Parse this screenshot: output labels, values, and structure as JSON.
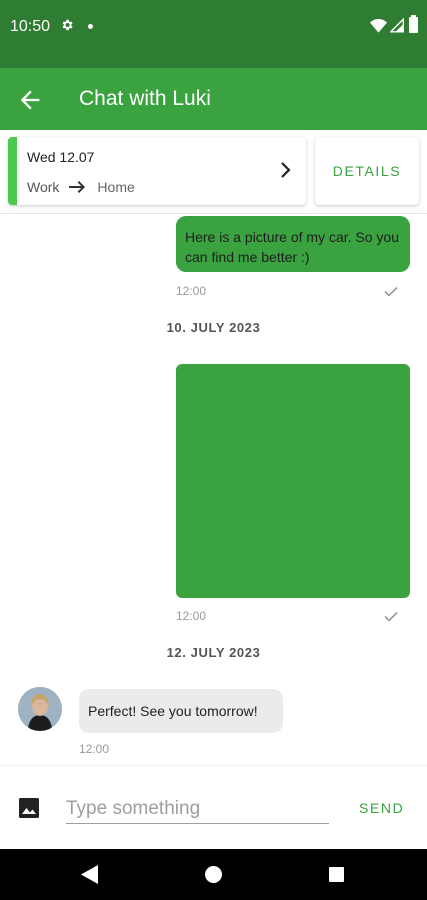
{
  "status_bar": {
    "time": "10:50"
  },
  "app_bar": {
    "title": "Chat with Luki"
  },
  "trip": {
    "date": "Wed 12.07",
    "from": "Work",
    "to": "Home"
  },
  "details_label": "DETAILS",
  "messages": [
    {
      "type": "text",
      "direction": "outgoing",
      "text": "Here is a picture of my car. So you can find me better :)",
      "time": "12:00",
      "status": "sent"
    },
    {
      "type": "date",
      "label": "10. JULY 2023"
    },
    {
      "type": "image",
      "direction": "outgoing",
      "time": "12:00",
      "status": "sent"
    },
    {
      "type": "date",
      "label": "12. JULY 2023"
    },
    {
      "type": "text",
      "direction": "incoming",
      "text": "Perfect! See you tomorrow!",
      "time": "12:00"
    }
  ],
  "composer": {
    "placeholder": "Type something",
    "value": "",
    "send_label": "SEND"
  },
  "colors": {
    "status_bar": "#2e7d32",
    "app_bar": "#3aa23f",
    "accent": "#4cc94f",
    "incoming_bubble": "#ebebeb"
  },
  "icons": [
    "settings-icon",
    "wifi-icon",
    "signal-icon",
    "battery-icon",
    "back-arrow-icon",
    "arrow-right-icon",
    "chevron-right-icon",
    "check-icon",
    "image-icon",
    "nav-back-icon",
    "nav-home-icon",
    "nav-recents-icon"
  ]
}
